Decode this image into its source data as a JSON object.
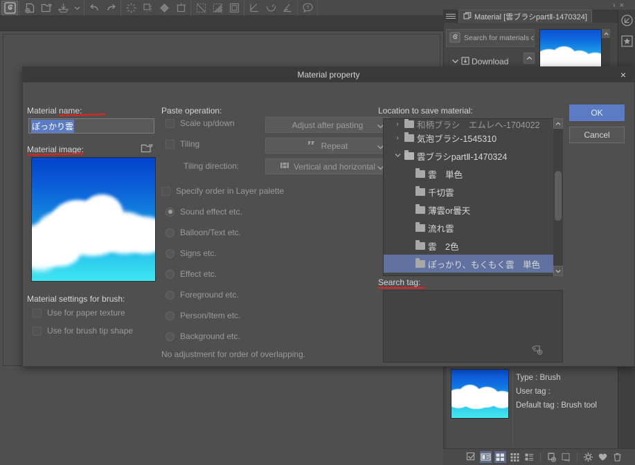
{
  "toolbar": {
    "groups": [
      {
        "buttons": [
          {
            "icon": "clip-studio-logo-icon",
            "selected": true
          }
        ]
      },
      {
        "buttons": [
          {
            "icon": "new-document-icon"
          },
          {
            "icon": "open-file-icon"
          },
          {
            "icon": "save-icon"
          },
          {
            "icon": "chevron-down-icon"
          }
        ]
      },
      {
        "buttons": [
          {
            "icon": "undo-icon"
          },
          {
            "icon": "redo-icon"
          }
        ]
      },
      {
        "buttons": [
          {
            "icon": "clear-icon"
          },
          {
            "icon": "fill-selection-icon"
          },
          {
            "icon": "fill-icon"
          },
          {
            "icon": "scale-rotate-icon"
          }
        ]
      },
      {
        "buttons": [
          {
            "icon": "select-all-icon"
          },
          {
            "icon": "deselect-icon"
          },
          {
            "icon": "invert-selection-icon"
          }
        ]
      },
      {
        "buttons": [
          {
            "icon": "snap-parallel-icon"
          },
          {
            "icon": "snap-curve-icon"
          },
          {
            "icon": "snap-perspective-icon"
          }
        ]
      },
      {
        "buttons": [
          {
            "icon": "help-icon"
          }
        ]
      }
    ],
    "sub_chevron": "chevron-down-icon"
  },
  "dialog": {
    "title": "Material property",
    "close_icon": "close-icon",
    "left": {
      "material_name_label": "Material name:",
      "material_name_value": "ぽっかり雲",
      "material_image_label": "Material image:",
      "material_image_open_icon": "open-folder-icon",
      "brush_settings_label": "Material settings for brush:",
      "checkboxes": [
        {
          "label": "Use for paper texture",
          "checked": false,
          "disabled": true
        },
        {
          "label": "Use for brush tip shape",
          "checked": false,
          "disabled": true
        }
      ]
    },
    "middle": {
      "paste_operation_label": "Paste operation:",
      "checkboxes": [
        {
          "label": "Scale up/down",
          "checked": false,
          "disabled": true
        },
        {
          "label": "Tiling",
          "checked": false,
          "disabled": true
        }
      ],
      "tiling_direction_label": "Tiling direction:",
      "combos": [
        {
          "name": "scale-combo",
          "value": "Adjust after pasting",
          "icon": ""
        },
        {
          "name": "tiling-combo",
          "value": "Repeat",
          "icon": "repeat-icon"
        },
        {
          "name": "tiling-direction-combo",
          "value": "Vertical and horizontal",
          "icon": "grid-icon"
        }
      ],
      "order_checkbox": {
        "label": "Specify order in Layer palette",
        "checked": false,
        "disabled": true
      },
      "radios": [
        {
          "label": "Sound effect etc.",
          "selected": true
        },
        {
          "label": "Balloon/Text etc.",
          "selected": false
        },
        {
          "label": "Signs etc.",
          "selected": false
        },
        {
          "label": "Effect etc.",
          "selected": false
        },
        {
          "label": "Foreground etc.",
          "selected": false
        },
        {
          "label": "Person/Item etc.",
          "selected": false
        },
        {
          "label": "Background etc.",
          "selected": false
        }
      ],
      "note": "No adjustment for order of overlapping."
    },
    "right": {
      "location_label": "Location to save material:",
      "tree": [
        {
          "label": "和柄ブラシ　エムレヘ-1704022",
          "depth": 1,
          "twisty": "collapsed",
          "selected": false,
          "clipped": true
        },
        {
          "label": "気泡ブラシ-1545310",
          "depth": 1,
          "twisty": "collapsed",
          "selected": false
        },
        {
          "label": "雲ブラシpartⅡ-1470324",
          "depth": 1,
          "twisty": "expanded",
          "selected": false
        },
        {
          "label": "雲　単色",
          "depth": 2,
          "twisty": "none",
          "selected": false
        },
        {
          "label": "千切雲",
          "depth": 2,
          "twisty": "none",
          "selected": false
        },
        {
          "label": "薄雲or曇天",
          "depth": 2,
          "twisty": "none",
          "selected": false
        },
        {
          "label": "流れ雲",
          "depth": 2,
          "twisty": "none",
          "selected": false
        },
        {
          "label": "雲　2色",
          "depth": 2,
          "twisty": "none",
          "selected": false
        },
        {
          "label": "ぽっかり、もくもく雲　単色",
          "depth": 2,
          "twisty": "none",
          "selected": true
        }
      ],
      "search_tag_label": "Search tag:",
      "search_tag_value": "",
      "search_tag_add_icon": "add-tag-icon"
    },
    "buttons": {
      "ok": "OK",
      "cancel": "Cancel"
    }
  },
  "palette": {
    "menu_icon": "hamburger-icon",
    "tab_icon": "material-icon",
    "tab_label": "Material [雲ブラシpartⅡ-1470324]",
    "search_icon": "clip-studio-logo-icon",
    "search_label": "Search for materials on AS",
    "download_label": "Download",
    "download_icon": "download-icon",
    "tree_chevron": "chevron-down-icon",
    "scroll_up_icon": "chevron-up-icon",
    "scroll_down_icon": "chevron-down-icon"
  },
  "info_panel": {
    "thumbnail": "cloud-thumbnail",
    "rows": [
      "Type : Brush",
      "User tag :",
      "Default tag : Brush tool"
    ]
  },
  "bottom_bar": {
    "buttons": [
      {
        "icon": "checkbox-select-icon",
        "active": false
      },
      {
        "icon": "list-detail-view-icon",
        "active": true
      },
      {
        "icon": "thumbnail-grid-view-icon",
        "active": true
      },
      {
        "icon": "small-grid-view-icon",
        "active": false
      },
      {
        "icon": "list-view-icon",
        "active": false
      },
      {
        "icon": "paste-material-icon",
        "active": false
      },
      {
        "icon": "replace-material-icon",
        "active": false
      },
      {
        "icon": "settings-gear-icon",
        "active": false
      },
      {
        "icon": "favorite-heart-icon",
        "active": false
      },
      {
        "icon": "delete-trash-icon",
        "active": false
      }
    ]
  },
  "right_strip": {
    "buttons": [
      {
        "icon": "navigator-icon"
      },
      {
        "icon": "favorite-star-icon"
      }
    ]
  },
  "colors": {
    "accent": "#5b7cc4",
    "selection": "#6272a0",
    "annotation_red": "#f01d1d",
    "panel_bg": "#4f4f4f",
    "titlebar_bg": "#3a3a3a",
    "sky_top": "#0a4fd0",
    "sky_bottom": "#48e8f0"
  }
}
